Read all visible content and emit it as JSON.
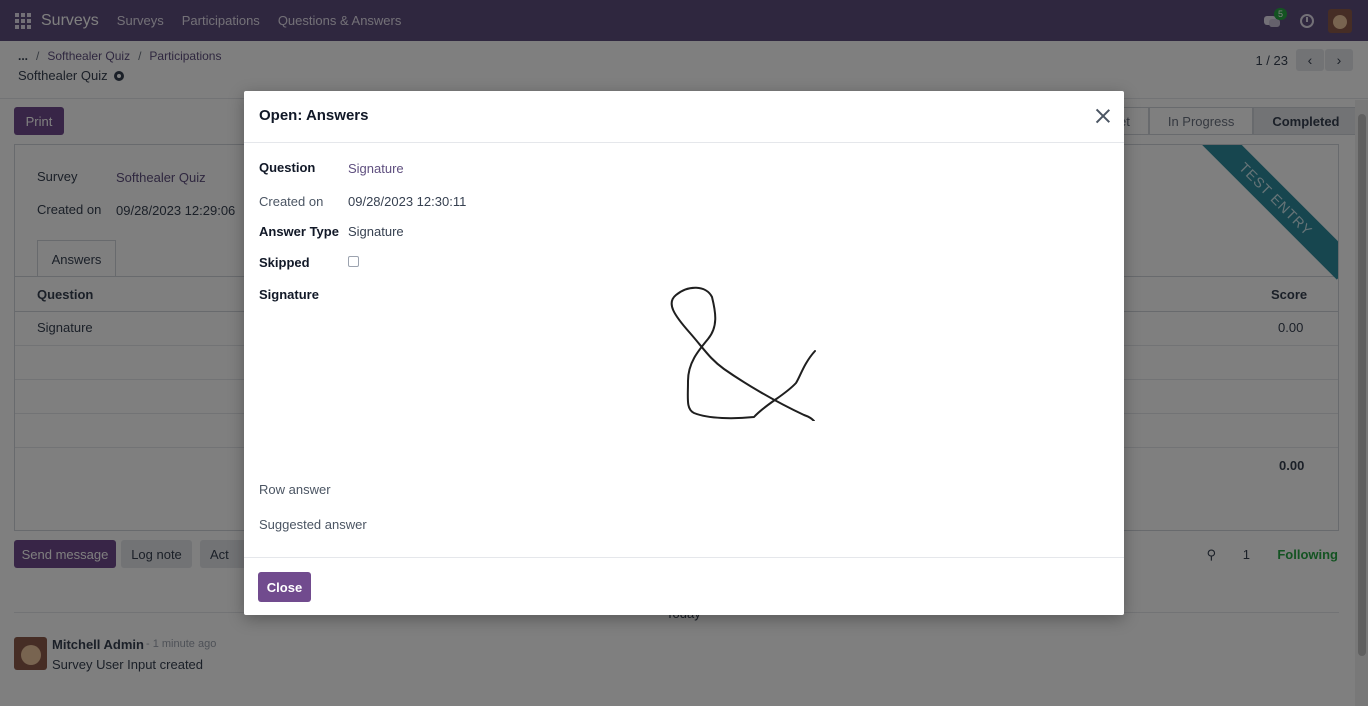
{
  "navbar": {
    "app_name": "Surveys",
    "menu": [
      "Surveys",
      "Participations",
      "Questions & Answers"
    ],
    "chat_badge": "5",
    "brand_color": "#5f4f7f"
  },
  "breadcrumb": {
    "dots": "...",
    "items": [
      "Softhealer Quiz",
      "Participations"
    ]
  },
  "record": {
    "title": "Softhealer Quiz",
    "pager": "1 / 23",
    "prev": "‹",
    "next": "›"
  },
  "form": {
    "print_label": "Print",
    "stages": [
      "et",
      "In Progress",
      "Completed"
    ],
    "survey_label": "Survey",
    "survey_value": "Softhealer Quiz",
    "created_on_label": "Created on",
    "created_on_value": "09/28/2023 12:29:06",
    "tab_answers": "Answers",
    "col_question": "Question",
    "col_score": "Score",
    "row_question": "Signature",
    "row_score": "0.00",
    "total_score": "0.00",
    "ribbon": "TEST ENTRY"
  },
  "chatter": {
    "send_message": "Send message",
    "log_note": "Log note",
    "activities": "Act",
    "followers_count": "1",
    "following": "Following",
    "today": "Today",
    "author": "Mitchell Admin",
    "time": "- 1 minute ago",
    "body": "Survey User Input created"
  },
  "modal": {
    "title": "Open: Answers",
    "question_label": "Question",
    "question_value": "Signature",
    "created_on_label": "Created on",
    "created_on_value": "09/28/2023 12:30:11",
    "answer_type_label": "Answer Type",
    "answer_type_value": "Signature",
    "skipped_label": "Skipped",
    "signature_label": "Signature",
    "row_answer_label": "Row answer",
    "suggested_answer_label": "Suggested answer",
    "close_label": "Close"
  }
}
